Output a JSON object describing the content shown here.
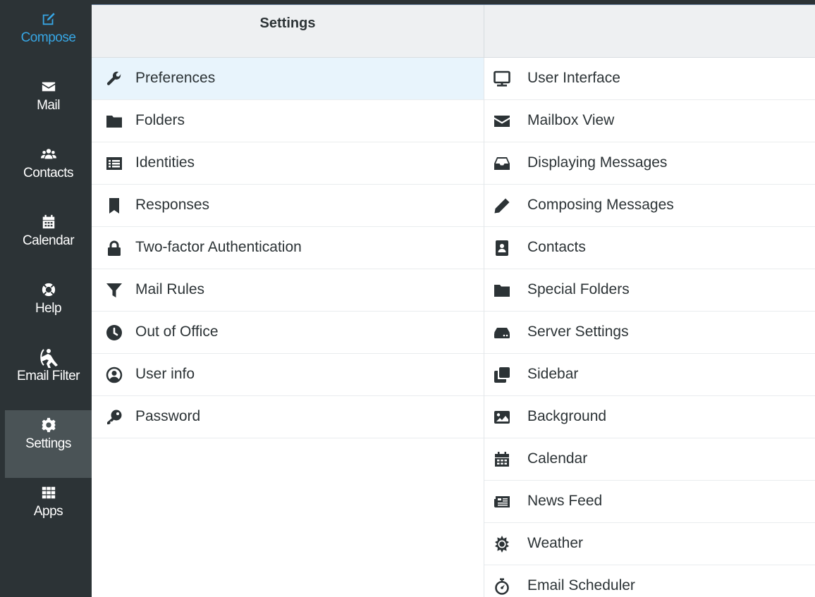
{
  "colors": {
    "sidebar_bg": "#2c3336",
    "sidebar_selected_bg": "#4a5356",
    "accent": "#37a6e4",
    "header_bg": "#eef0f2",
    "row_selected_bg": "#e8f4fc",
    "text": "#2c3336"
  },
  "sidebar": {
    "items": [
      {
        "label": "Compose",
        "icon": "compose-icon"
      },
      {
        "label": "Mail",
        "icon": "envelope-icon"
      },
      {
        "label": "Contacts",
        "icon": "users-icon"
      },
      {
        "label": "Calendar",
        "icon": "calendar-icon"
      },
      {
        "label": "Help",
        "icon": "lifebuoy-icon"
      },
      {
        "label": "Email Filter",
        "icon": "email-filter-icon"
      },
      {
        "label": "Settings",
        "icon": "gear-icon",
        "selected": true
      },
      {
        "label": "Apps",
        "icon": "grid-icon"
      }
    ]
  },
  "header": {
    "title": "Settings"
  },
  "settings_sections": [
    {
      "label": "Preferences",
      "icon": "wrench-icon",
      "selected": true
    },
    {
      "label": "Folders",
      "icon": "folder-icon"
    },
    {
      "label": "Identities",
      "icon": "id-list-icon"
    },
    {
      "label": "Responses",
      "icon": "bookmark-icon"
    },
    {
      "label": "Two-factor Authentication",
      "icon": "lock-icon"
    },
    {
      "label": "Mail Rules",
      "icon": "filter-icon"
    },
    {
      "label": "Out of Office",
      "icon": "clock-icon"
    },
    {
      "label": "User info",
      "icon": "user-circle-icon"
    },
    {
      "label": "Password",
      "icon": "key-icon"
    }
  ],
  "preference_sections": [
    {
      "label": "User Interface",
      "icon": "monitor-icon"
    },
    {
      "label": "Mailbox View",
      "icon": "envelope-icon"
    },
    {
      "label": "Displaying Messages",
      "icon": "inbox-icon"
    },
    {
      "label": "Composing Messages",
      "icon": "pencil-icon"
    },
    {
      "label": "Contacts",
      "icon": "address-book-icon"
    },
    {
      "label": "Special Folders",
      "icon": "folder-icon"
    },
    {
      "label": "Server Settings",
      "icon": "hdd-icon"
    },
    {
      "label": "Sidebar",
      "icon": "clone-icon"
    },
    {
      "label": "Background",
      "icon": "image-icon"
    },
    {
      "label": "Calendar",
      "icon": "calendar-icon"
    },
    {
      "label": "News Feed",
      "icon": "newspaper-icon"
    },
    {
      "label": "Weather",
      "icon": "sun-icon"
    },
    {
      "label": "Email Scheduler",
      "icon": "stopwatch-icon"
    }
  ]
}
